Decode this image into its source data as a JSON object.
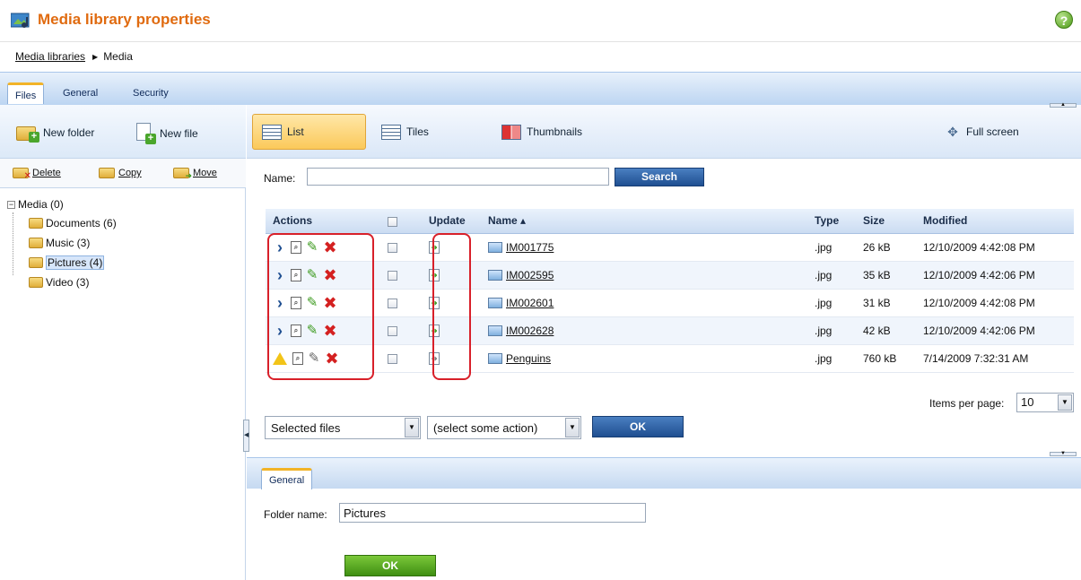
{
  "title": {
    "text": "Media library properties"
  },
  "breadcrumb": {
    "link": "Media libraries",
    "current": "Media"
  },
  "tabs": [
    {
      "label": "Files"
    },
    {
      "label": "General"
    },
    {
      "label": "Security"
    }
  ],
  "left_toolbar": {
    "new_folder": "New folder",
    "new_file": "New file"
  },
  "left_actions": {
    "delete": "Delete",
    "copy": "Copy",
    "move": "Move"
  },
  "tree": [
    {
      "label": "Media (0)"
    },
    {
      "label": "Documents (6)"
    },
    {
      "label": "Music (3)"
    },
    {
      "label": "Pictures (4)"
    },
    {
      "label": "Video (3)"
    }
  ],
  "views": {
    "list": "List",
    "tiles": "Tiles",
    "thumbnails": "Thumbnails",
    "full_screen": "Full screen"
  },
  "search": {
    "label": "Name:",
    "value": "",
    "button": "Search"
  },
  "grid": {
    "headers": {
      "actions": "Actions",
      "update": "Update",
      "name": "Name ▴",
      "type": "Type",
      "size": "Size",
      "modified": "Modified"
    },
    "rows": [
      {
        "name": "IM001775",
        "type": ".jpg",
        "size": "26 kB",
        "modified": "12/10/2009 4:42:08 PM"
      },
      {
        "name": "IM002595",
        "type": ".jpg",
        "size": "35 kB",
        "modified": "12/10/2009 4:42:06 PM"
      },
      {
        "name": "IM002601",
        "type": ".jpg",
        "size": "31 kB",
        "modified": "12/10/2009 4:42:08 PM"
      },
      {
        "name": "IM002628",
        "type": ".jpg",
        "size": "42 kB",
        "modified": "12/10/2009 4:42:06 PM"
      },
      {
        "name": "Penguins",
        "type": ".jpg",
        "size": "760 kB",
        "modified": "7/14/2009 7:32:31 AM"
      }
    ]
  },
  "pager": {
    "label": "Items per page:",
    "value": "10"
  },
  "bulk": {
    "selection": "Selected files",
    "action": "(select some action)",
    "ok": "OK"
  },
  "properties": {
    "tab": "General",
    "folder_label": "Folder name:",
    "folder_value": "Pictures",
    "ok": "OK"
  },
  "colors": {
    "title": "#e06b10",
    "accent_blue": "#1f4f91",
    "ok_green": "#3f8f12",
    "highlight": "#d8202a"
  }
}
